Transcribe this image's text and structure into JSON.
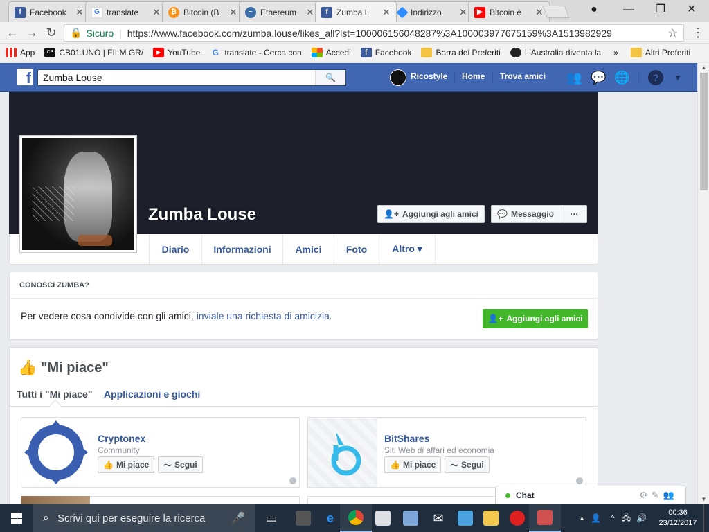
{
  "browser": {
    "tabs": [
      {
        "label": "Facebook",
        "icon": "facebook-icon",
        "color": "#3b5998"
      },
      {
        "label": "translate",
        "icon": "google-icon",
        "color": "#4285f4"
      },
      {
        "label": "Bitcoin (B",
        "icon": "bitcoin-icon",
        "color": "#f7931a"
      },
      {
        "label": "Ethereum",
        "icon": "ethereum-chart-icon",
        "color": "#3a6ea5"
      },
      {
        "label": "Zumba L",
        "icon": "facebook-icon",
        "color": "#3b5998"
      },
      {
        "label": "Indirizzo",
        "icon": "diamond-icon",
        "color": "#2d8cff"
      },
      {
        "label": "Bitcoin è",
        "icon": "youtube-icon",
        "color": "#ff0000"
      }
    ],
    "secure_label": "Sicuro",
    "url": "https://www.facebook.com/zumba.louse/likes_all?lst=100006156048287%3A100003977675159%3A1513982929",
    "bookmarks": [
      {
        "label": "App",
        "icon": "apps-grid-icon",
        "color": "#d93025"
      },
      {
        "label": "CB01.UNO | FILM GR/",
        "icon": "cb01-icon",
        "color": "#111111"
      },
      {
        "label": "YouTube",
        "icon": "youtube-icon",
        "color": "#ff0000"
      },
      {
        "label": "translate - Cerca con",
        "icon": "google-icon",
        "color": "#4285f4"
      },
      {
        "label": "Accedi",
        "icon": "microsoft-icon",
        "color": "#f25022"
      },
      {
        "label": "Facebook",
        "icon": "facebook-icon",
        "color": "#3b5998"
      },
      {
        "label": "Barra dei Preferiti",
        "icon": "folder-icon",
        "color": "#f4c542"
      },
      {
        "label": "L'Australia diventa la",
        "icon": "news-icon",
        "color": "#222222"
      }
    ],
    "bookmarks_more": "»",
    "other_bookmarks": "Altri Preferiti"
  },
  "fb": {
    "search_value": "Zumba Louse",
    "user_name": "Ricostyle",
    "nav_home": "Home",
    "nav_find_friends": "Trova amici",
    "brand_color": "#4267b2"
  },
  "profile": {
    "name": "Zumba Louse",
    "add_friend": "Aggiungi agli amici",
    "message": "Messaggio",
    "more": "···",
    "tabs": [
      "Diario",
      "Informazioni",
      "Amici",
      "Foto",
      "Altro ▾"
    ]
  },
  "know": {
    "header": "CONOSCI ZUMBA?",
    "text": "Per vedere cosa condivide con gli amici, ",
    "link": "inviale una richiesta di amicizia",
    "period": ".",
    "button": "Aggiungi agli amici",
    "button_color": "#42b72a"
  },
  "likes": {
    "title": "\"Mi piace\"",
    "tab_all": "Tutti i \"Mi piace\"",
    "tab_apps": "Applicazioni e giochi",
    "pages": [
      {
        "name": "Cryptonex",
        "category": "Community",
        "like": "Mi piace",
        "follow": "Segui"
      },
      {
        "name": "BitShares",
        "category": "Siti Web di affari ed economia",
        "like": "Mi piace",
        "follow": "Segui"
      }
    ]
  },
  "chat": {
    "label": "Chat"
  },
  "taskbar": {
    "search_placeholder": "Scrivi qui per eseguire la ricerca",
    "time": "00:36",
    "date": "23/12/2017"
  }
}
